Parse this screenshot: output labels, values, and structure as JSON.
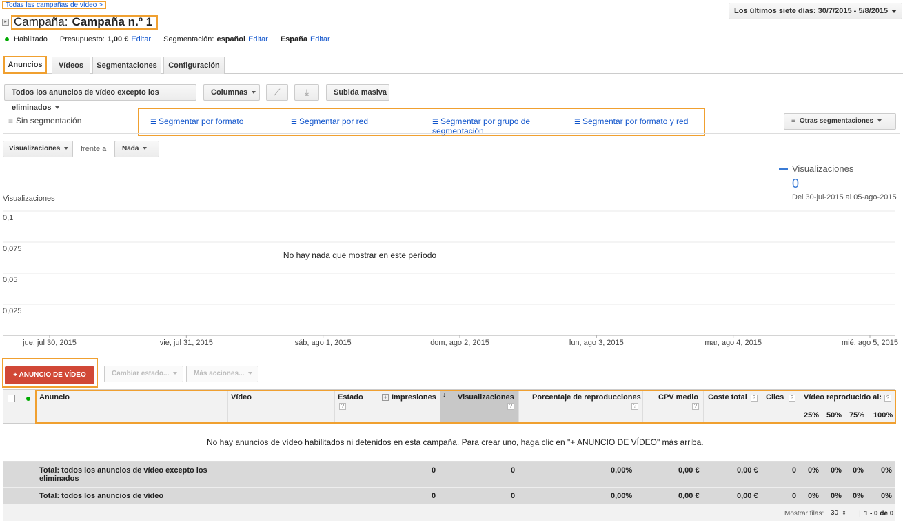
{
  "breadcrumb": "Todas las campañas de vídeo >",
  "campaign": {
    "prefix": "Campaña:",
    "name": "Campaña n.º 1"
  },
  "date_range": "Los últimos siete días: 30/7/2015 - 5/8/2015",
  "status": {
    "state": "Habilitado",
    "budget_label": "Presupuesto:",
    "budget_value": "1,00 €",
    "edit": "Editar",
    "targeting_label": "Segmentación:",
    "targeting_value": "español",
    "location": "España"
  },
  "tabs": [
    "Anuncios",
    "Vídeos",
    "Segmentaciones",
    "Configuración"
  ],
  "toolbar": {
    "filter": "Todos los anuncios de vídeo excepto los eliminados",
    "columns": "Columnas",
    "bulk_upload": "Subida masiva"
  },
  "segments": {
    "none": "Sin segmentación",
    "by_format": "Segmentar por formato",
    "by_network": "Segmentar por red",
    "by_group": "Segmentar por grupo de segmentación",
    "by_format_network": "Segmentar por formato y red",
    "other": "Otras segmentaciones"
  },
  "metric_selector": {
    "metric": "Visualizaciones",
    "versus": "frente a",
    "compare": "Nada"
  },
  "legend": {
    "name": "Visualizaciones",
    "value": "0",
    "range": "Del 30-jul-2015 al 05-ago-2015"
  },
  "chart_data": {
    "type": "line",
    "ylabel": "Visualizaciones",
    "y_ticks": [
      "0,1",
      "0,075",
      "0,05",
      "0,025"
    ],
    "ylim": [
      0,
      0.1
    ],
    "x": [
      "jue, jul 30, 2015",
      "vie, jul 31, 2015",
      "sáb, ago 1, 2015",
      "dom, ago 2, 2015",
      "lun, ago 3, 2015",
      "mar, ago 4, 2015",
      "mié, ago 5, 2015"
    ],
    "series": [],
    "empty_message": "No hay nada que mostrar en este período",
    "grid": true
  },
  "actions": {
    "add_ad": "+ ANUNCIO DE VÍDEO",
    "change_status": "Cambiar estado...",
    "more_actions": "Más acciones..."
  },
  "table": {
    "headers": {
      "ad": "Anuncio",
      "video": "Vídeo",
      "status": "Estado",
      "impressions": "Impresiones",
      "views": "Visualizaciones",
      "view_rate": "Porcentaje de reproducciones",
      "avg_cpv": "CPV medio",
      "cost": "Coste total",
      "clicks": "Clics",
      "played_to": "Vídeo reproducido al:",
      "q25": "25%",
      "q50": "50%",
      "q75": "75%",
      "q100": "100%"
    },
    "help_mark": "?",
    "empty_message": "No hay anuncios de vídeo habilitados ni detenidos en esta campaña. Para crear uno, haga clic en \"+ ANUNCIO DE VÍDEO\" más arriba.",
    "totals": [
      {
        "label": "Total: todos los anuncios de vídeo excepto los eliminados",
        "impressions": "0",
        "views": "0",
        "view_rate": "0,00%",
        "avg_cpv": "0,00 €",
        "cost": "0,00 €",
        "clicks": "0",
        "q25": "0%",
        "q50": "0%",
        "q75": "0%",
        "q100": "0%"
      },
      {
        "label": "Total: todos los anuncios de vídeo",
        "impressions": "0",
        "views": "0",
        "view_rate": "0,00%",
        "avg_cpv": "0,00 €",
        "cost": "0,00 €",
        "clicks": "0",
        "q25": "0%",
        "q50": "0%",
        "q75": "0%",
        "q100": "0%"
      }
    ]
  },
  "footer": {
    "rows_label": "Mostrar filas:",
    "rows_value": "30",
    "pager": "1 - 0 de 0"
  }
}
